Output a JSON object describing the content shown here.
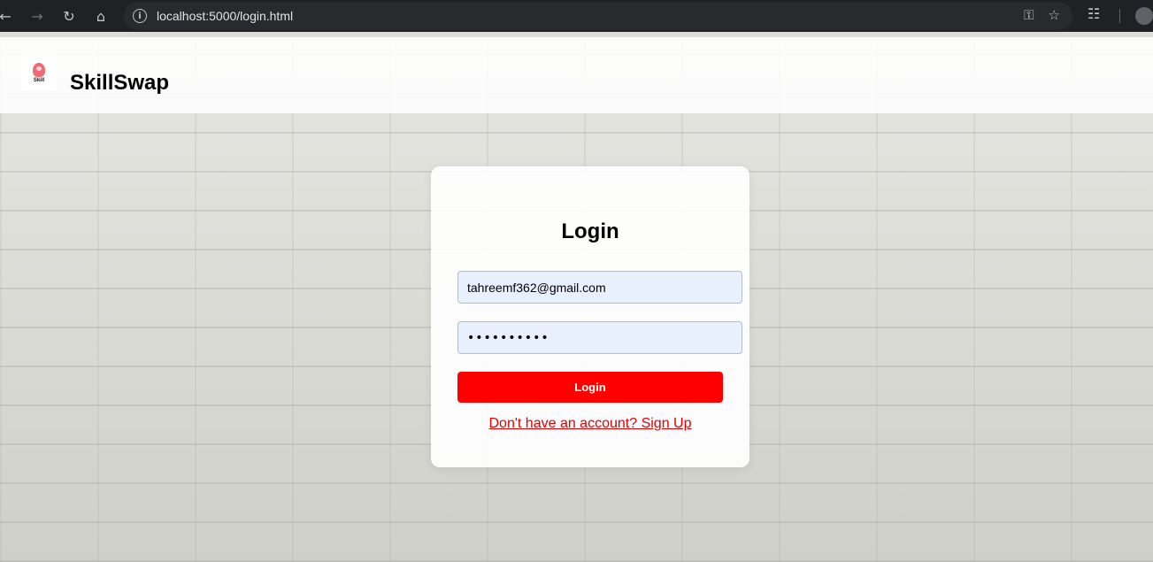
{
  "browser": {
    "url": "localhost:5000/login.html",
    "icons": [
      "back-arrow-icon",
      "forward-arrow-icon",
      "reload-icon",
      "home-icon",
      "site-info-icon",
      "password-key-icon",
      "bookmark-star-icon",
      "extensions-icon",
      "profile-icon"
    ]
  },
  "header": {
    "logo_text": "Skill",
    "brand": "SkillSwap"
  },
  "login": {
    "title": "Login",
    "email_value": "tahreemf362@gmail.com",
    "password_value": "1234567890",
    "button_label": "Login",
    "signup_link": "Don't have an account? Sign Up"
  },
  "colors": {
    "accent": "#ff0000",
    "input_bg": "#e8f0fe",
    "chrome_bg": "#202124"
  }
}
